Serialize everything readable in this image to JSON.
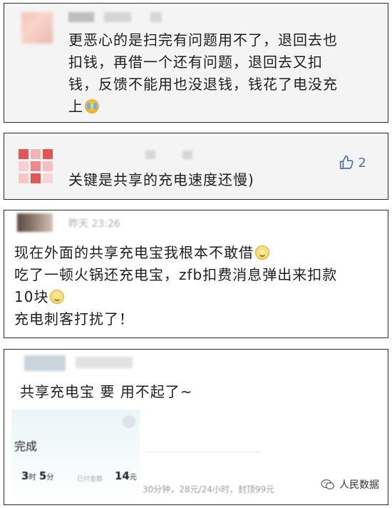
{
  "comments": [
    {
      "text_lines": [
        "更恶心的是扫完有问题用不了，退回去也",
        "扣钱，再借一个还有问题，退回去又扣",
        "钱，反馈不能用也没退钱，钱花了电没充",
        "上"
      ],
      "emoji": "loudly-crying-emoji"
    },
    {
      "text": "关键是共享的充电速度还慢)",
      "likes": "2"
    },
    {
      "time": "昨天 23:26",
      "text_lines": [
        "现在外面的共享充电宝我根本不敢借",
        "吃了一顿火锅还充电宝，zfb扣费消息弹出来扣款",
        "10块",
        "充电刺客打扰了！"
      ],
      "emoji": "smiling-emoji"
    },
    {
      "text": "共享充电宝 要 用不起了~",
      "preview": {
        "status": "完成",
        "duration_h": "3",
        "duration_h_unit": "时",
        "duration_m": "5",
        "duration_m_unit": "分",
        "paid_label": "已付金额",
        "paid_value": "14",
        "paid_unit": "元",
        "pricing": "30分钟，28元/24小时，封顶99元"
      }
    }
  ],
  "watermark": {
    "label": "人民数据"
  },
  "colors": {
    "like": "#4a6fb0",
    "border": "#2a2a2a",
    "card_bg": "#f4f4f4"
  }
}
